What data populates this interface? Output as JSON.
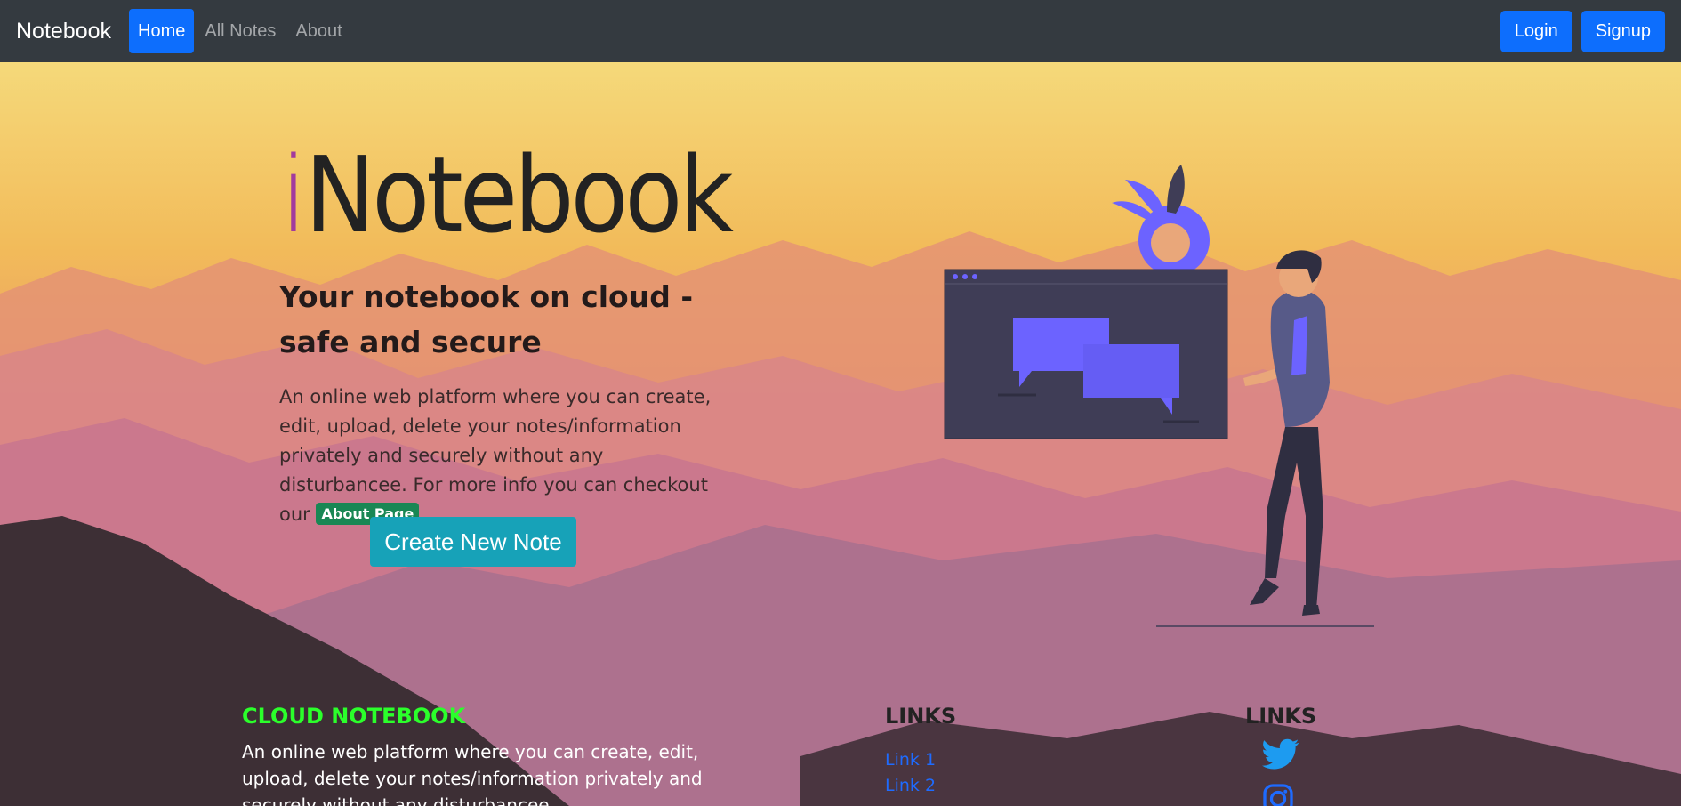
{
  "navbar": {
    "brand": "Notebook",
    "links": [
      "Home",
      "All Notes",
      "About"
    ],
    "login": "Login",
    "signup": "Signup"
  },
  "hero": {
    "title_first": "i",
    "title_rest": "Notebook",
    "subtitle": "Your notebook on cloud - safe and secure",
    "description": "An online web platform where you can create, edit, upload, delete your notes/information privately and securely without any disturbancee. For more info you can checkout our",
    "about_badge": "About Page",
    "create_button": "Create New Note"
  },
  "footer": {
    "brand_heading": "CLOUD NOTEBOOK",
    "description": "An online web platform where you can create, edit, upload, delete your notes/information privately and securely without any disturbancee.",
    "links_heading": "LINKS",
    "links": [
      "Link 1",
      "Link 2"
    ],
    "social_heading": "LINKS",
    "social_icons": [
      "twitter-icon",
      "instagram-icon"
    ]
  },
  "colors": {
    "navbar_bg": "#343a40",
    "primary": "#0d6efd",
    "info": "#17a2b8",
    "success": "#198754",
    "footer_brand": "#2bff2b",
    "illustration_accent": "#6c63ff"
  }
}
